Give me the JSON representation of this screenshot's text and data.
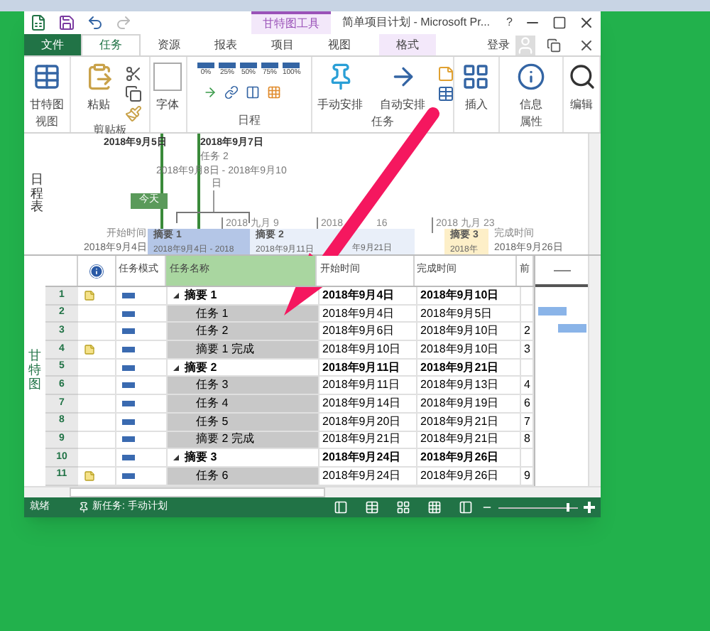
{
  "window": {
    "title": "简单项目计划 - Microsoft Pr...",
    "context_tab_group": "甘特图工具",
    "help": "?"
  },
  "tabs": [
    {
      "label": "文件",
      "kind": "file",
      "selected": false
    },
    {
      "label": "任务",
      "kind": "tab",
      "selected": true
    },
    {
      "label": "资源",
      "kind": "tab",
      "selected": false
    },
    {
      "label": "报表",
      "kind": "tab",
      "selected": false
    },
    {
      "label": "项目",
      "kind": "tab",
      "selected": false
    },
    {
      "label": "视图",
      "kind": "tab",
      "selected": false
    },
    {
      "label": "格式",
      "kind": "context",
      "selected": false
    }
  ],
  "account": {
    "label": "登录"
  },
  "ribbon": {
    "groups": [
      {
        "label": "视图",
        "buttons": [
          "甘特图"
        ]
      },
      {
        "label": "剪贴板",
        "buttons": [
          "粘贴"
        ]
      },
      {
        "buttons": [
          "字体"
        ]
      },
      {
        "label": "日程",
        "progress": [
          "0%",
          "25%",
          "50%",
          "75%",
          "100%"
        ]
      },
      {
        "label": "任务",
        "buttons": [
          "手动安排",
          "自动安排"
        ]
      },
      {
        "buttons": [
          "插入"
        ]
      },
      {
        "label": "属性",
        "buttons": [
          "信息"
        ]
      },
      {
        "buttons": [
          "编辑"
        ]
      }
    ]
  },
  "timeline": {
    "side_label": "日程表",
    "today": "今天",
    "markers": [
      {
        "date": "2018年9月5日"
      },
      {
        "date": "2018年9月7日"
      }
    ],
    "callout": {
      "name": "任务 2",
      "range": "2018年9月8日 - 2018年9月10",
      "range_end": "日"
    },
    "ticks": [
      {
        "label": "2018 九月 9"
      },
      {
        "label": "2018",
        "label_end": "16"
      },
      {
        "label": "2018 九月 23"
      }
    ],
    "start": {
      "label": "开始时间",
      "date": "2018年9月4日"
    },
    "finish": {
      "label": "完成时间",
      "date": "2018年9月26日"
    },
    "bars": [
      {
        "name": "摘要 1",
        "range": "2018年9月4日 - 2018",
        "color": "#b4c6e7"
      },
      {
        "name": "摘要 2",
        "range": "2018年9月11日",
        "range_end": "年9月21日",
        "color": "#e9eff9"
      },
      {
        "name": "摘要 3",
        "range": "2018年",
        "color": "#fdefc8"
      }
    ]
  },
  "table": {
    "side_label": "甘特图",
    "columns": [
      "任务模式",
      "任务名称",
      "开始时间",
      "完成时间",
      "前"
    ],
    "rows": [
      {
        "id": "1",
        "note": true,
        "name": "摘要 1",
        "summary": true,
        "start": "2018年9月4日",
        "finish": "2018年9月10日",
        "pred": ""
      },
      {
        "id": "2",
        "note": false,
        "name": "任务 1",
        "summary": false,
        "start": "2018年9月4日",
        "finish": "2018年9月5日",
        "pred": ""
      },
      {
        "id": "3",
        "note": false,
        "name": "任务 2",
        "summary": false,
        "start": "2018年9月6日",
        "finish": "2018年9月10日",
        "pred": "2"
      },
      {
        "id": "4",
        "note": true,
        "name": "摘要 1 完成",
        "summary": false,
        "start": "2018年9月10日",
        "finish": "2018年9月10日",
        "pred": "3"
      },
      {
        "id": "5",
        "note": false,
        "name": "摘要 2",
        "summary": true,
        "start": "2018年9月11日",
        "finish": "2018年9月21日",
        "pred": ""
      },
      {
        "id": "6",
        "note": false,
        "name": "任务 3",
        "summary": false,
        "start": "2018年9月11日",
        "finish": "2018年9月13日",
        "pred": "4"
      },
      {
        "id": "7",
        "note": false,
        "name": "任务 4",
        "summary": false,
        "start": "2018年9月14日",
        "finish": "2018年9月19日",
        "pred": "6"
      },
      {
        "id": "8",
        "note": false,
        "name": "任务 5",
        "summary": false,
        "start": "2018年9月20日",
        "finish": "2018年9月21日",
        "pred": "7"
      },
      {
        "id": "9",
        "note": false,
        "name": "摘要 2 完成",
        "summary": false,
        "start": "2018年9月21日",
        "finish": "2018年9月21日",
        "pred": "8"
      },
      {
        "id": "10",
        "note": false,
        "name": "摘要 3",
        "summary": true,
        "start": "2018年9月24日",
        "finish": "2018年9月26日",
        "pred": ""
      },
      {
        "id": "11",
        "note": true,
        "name": "任务 6",
        "summary": false,
        "start": "2018年9月24日",
        "finish": "2018年9月26日",
        "pred": "9"
      }
    ]
  },
  "status_bar": {
    "ready": "就绪",
    "new_task": "新任务: 手动计划",
    "zoom": {
      "level": 0.85
    }
  }
}
